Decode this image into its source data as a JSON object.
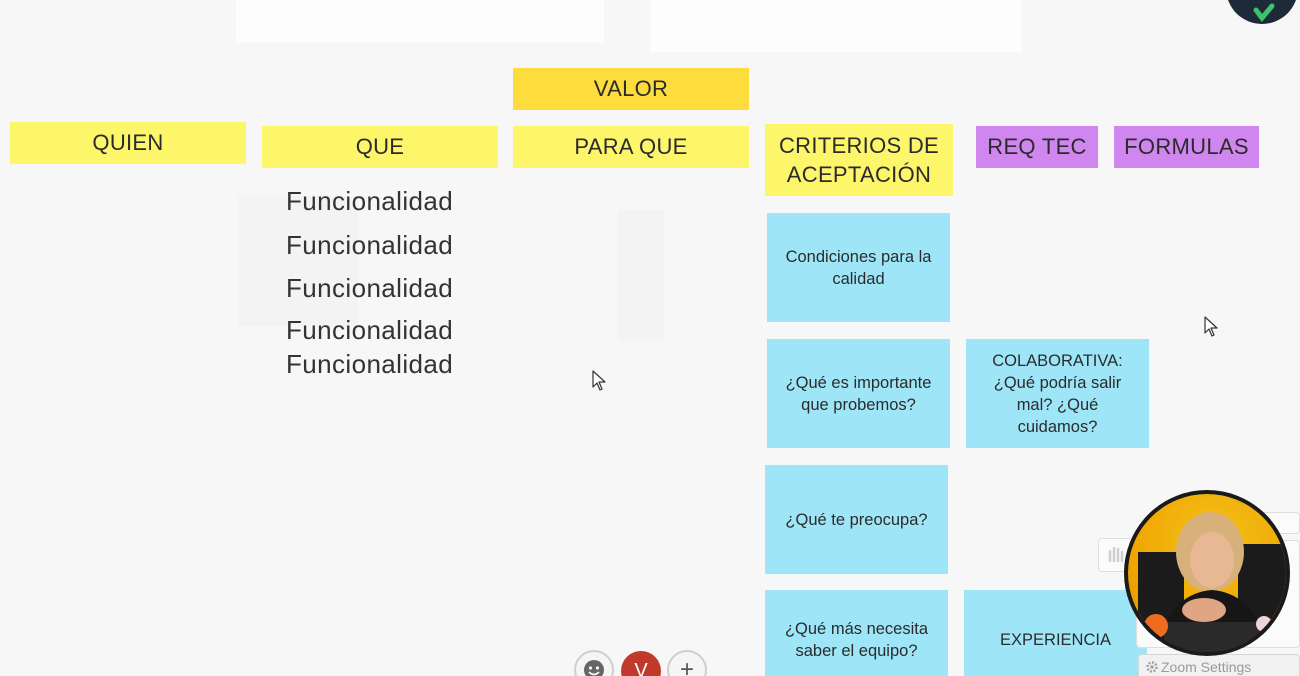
{
  "headers": {
    "valor": "VALOR",
    "quien": "QUIEN",
    "que": "QUE",
    "para_que": "PARA QUE",
    "criterios_line1": "CRITERIOS DE",
    "criterios_line2": "ACEPTACIÓN",
    "req_tec": "REQ TEC",
    "formulas": "FORMULAS"
  },
  "funcionalidades": [
    "Funcionalidad",
    "Funcionalidad",
    "Funcionalidad",
    "Funcionalidad",
    "Funcionalidad"
  ],
  "criterios_notes": [
    "Condiciones para la calidad",
    "¿Qué es importante que probemos?",
    "¿Qué te preocupa?",
    "¿Qué más necesita saber el equipo?"
  ],
  "req_tec_notes": [
    "COLABORATIVA: ¿Qué podría salir mal? ¿Qué cuidamos?",
    "EXPERIENCIA"
  ],
  "toolbar": {
    "avatar_initial": "V",
    "add_symbol": "+"
  },
  "zoom_settings_label": "Zoom Settings",
  "colors": {
    "yellow": "#fdf56a",
    "gold": "#fddd3d",
    "purple": "#cf86ee",
    "cyan": "#9ee6f7",
    "avatar": "#c0392b"
  }
}
